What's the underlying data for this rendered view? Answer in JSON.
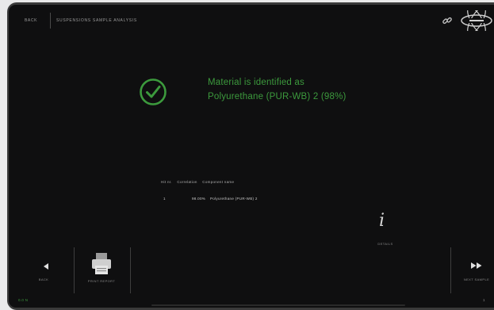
{
  "header": {
    "back_label": "BACK",
    "breadcrumb": "SUSPENSIONS SAMPLE ANALYSIS"
  },
  "result": {
    "line1": "Material is identified as",
    "line2": "Polyurethane (PUR-WB) 2 (98%)",
    "accent_color": "#3c9a3d"
  },
  "table": {
    "columns": [
      "Hit nr.",
      "Correlation",
      "Component name"
    ],
    "rows": [
      {
        "hit": "1",
        "correlation": "98.00%",
        "name": "Polyurethane (PUR-WB) 2"
      }
    ]
  },
  "details": {
    "glyph": "i",
    "label": "DETAILS"
  },
  "nav": {
    "back_label": "BACK",
    "print_label": "PRINT REPORT",
    "next_label": "NEXT SAMPLE"
  },
  "status": {
    "left": "0.0 N",
    "right": "1"
  },
  "icons": {
    "top_right": [
      "link-icon",
      "brand-logo"
    ],
    "result": "check-circle-icon",
    "print": "printer-icon",
    "back": "arrow-left-icon",
    "next": "fast-forward-icon"
  }
}
